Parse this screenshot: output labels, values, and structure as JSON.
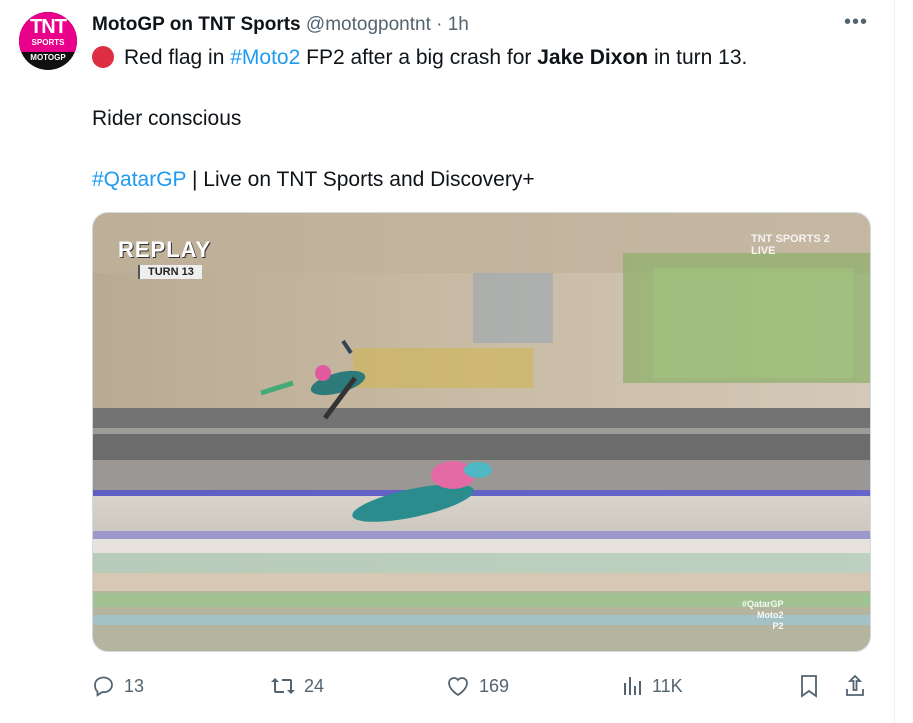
{
  "author": {
    "avatar_lines": [
      "TNT",
      "SPORTS",
      "MOTOGP"
    ],
    "name": "MotoGP on TNT Sports",
    "handle": "@motogpontnt",
    "separator": "·",
    "time": "1h"
  },
  "tweet": {
    "line1_pre": "Red flag in ",
    "line1_hashtag": "#Moto2",
    "line1_mid": " FP2 after a big crash for ",
    "line1_name": "Jake Dixon",
    "line1_post": " in turn 13.",
    "line2": "Rider conscious",
    "line3_hashtag": "#QatarGP",
    "line3_rest": " | Live on TNT Sports and Discovery+"
  },
  "media": {
    "replay": "REPLAY",
    "turn": "TURN 13",
    "broadcaster": "TNT SPORTS 2",
    "broadcaster_sub": "LIVE",
    "corner_tag_1": "#QatarGP",
    "corner_tag_2": "Moto2",
    "corner_tag_3": "P2"
  },
  "actions": {
    "replies": "13",
    "retweets": "24",
    "likes": "169",
    "views": "11K"
  },
  "icons": [
    "reply-icon",
    "retweet-icon",
    "like-icon",
    "views-icon",
    "bookmark-icon",
    "share-icon",
    "more-icon"
  ],
  "colors": {
    "link": "#1d9bf0",
    "muted": "#536471",
    "red_flag": "#dd2e44",
    "brand": "#e8008b"
  }
}
